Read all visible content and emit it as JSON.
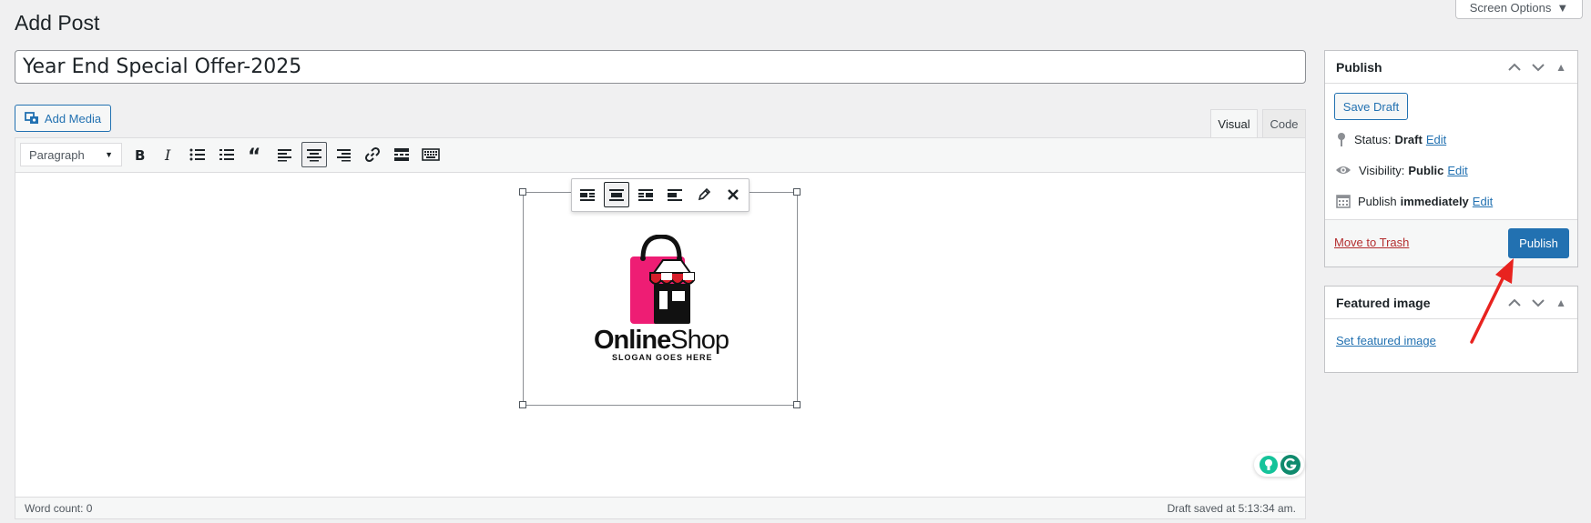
{
  "header": {
    "title": "Add Post",
    "screen_options": "Screen Options"
  },
  "post": {
    "title_value": "Year End Special Offer-2025"
  },
  "editor": {
    "add_media": "Add Media",
    "tabs": [
      {
        "label": "Visual",
        "active": true
      },
      {
        "label": "Code",
        "active": false
      }
    ],
    "format_select": "Paragraph",
    "toolbar_icons": [
      "bold-icon",
      "italic-icon",
      "bulleted-list-icon",
      "numbered-list-icon",
      "blockquote-icon",
      "align-left-icon",
      "align-center-icon",
      "align-right-icon",
      "link-icon",
      "read-more-icon",
      "toolbar-toggle-icon"
    ],
    "image_toolbar_icons": [
      "image-align-left-icon",
      "image-align-center-icon",
      "image-align-right-icon",
      "image-align-none-icon",
      "edit-pencil-icon",
      "remove-x-icon"
    ],
    "logo": {
      "word1": "Online",
      "word2": "Shop",
      "slogan": "SLOGAN GOES HERE",
      "pink": "#ee1d74",
      "dark": "#111111"
    },
    "word_count": "Word count: 0",
    "draft_saved": "Draft saved at 5:13:34 am."
  },
  "publish_box": {
    "title": "Publish",
    "save_draft": "Save Draft",
    "status_label": "Status:",
    "status_value": "Draft",
    "visibility_label": "Visibility:",
    "visibility_value": "Public",
    "publish_label": "Publish",
    "publish_value": "immediately",
    "edit": "Edit",
    "move_to_trash": "Move to Trash",
    "publish_button": "Publish"
  },
  "featured_box": {
    "title": "Featured image",
    "set_link": "Set featured image"
  },
  "colors": {
    "accent": "#2271b1",
    "danger": "#b32d2e",
    "arrow": "#e8231f"
  }
}
